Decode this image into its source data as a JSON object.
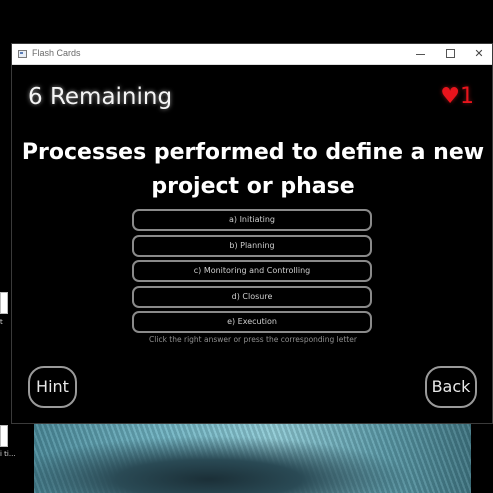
{
  "window": {
    "title": "Flash Cards",
    "minimize_glyph": "",
    "maximize_glyph": "",
    "close_glyph": "✕"
  },
  "status": {
    "remaining": "6 Remaining",
    "lives": "♥1",
    "lives_color": "#e8141c"
  },
  "question": {
    "line1": "Processes performed to define a new",
    "line2": "project or phase"
  },
  "answers": [
    "a) Initiating",
    "b) Planning",
    "c) Monitoring and Controlling",
    "d) Closure",
    "e) Execution"
  ],
  "instruction": "Click the right answer or press the corresponding letter",
  "buttons": {
    "hint": "Hint",
    "back": "Back"
  },
  "desktop": {
    "icon1_label": "t",
    "icon2_label": "i\nti..."
  },
  "icons": {
    "app": "app-window-icon",
    "minimize": "minimize-icon",
    "maximize": "maximize-icon",
    "close": "close-icon"
  }
}
